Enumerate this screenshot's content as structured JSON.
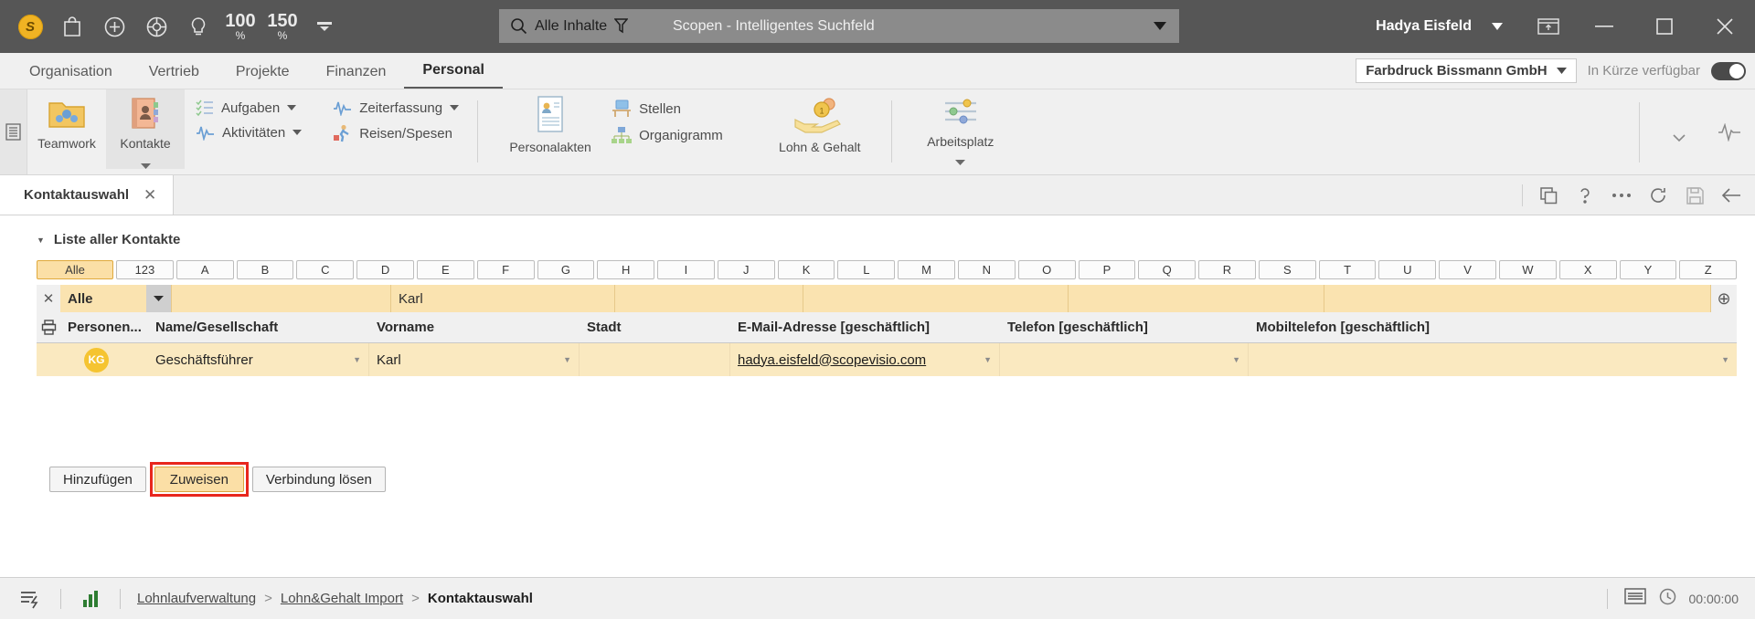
{
  "titlebar": {
    "icons": [
      "app-logo-icon",
      "shop-bag-icon",
      "plus-circle-icon",
      "lifebuoy-icon",
      "lightbulb-icon"
    ],
    "zoom1": "100",
    "zoom1_unit": "%",
    "zoom2": "150",
    "zoom2_unit": "%",
    "overflow": "more-icon",
    "search_scope": "Alle Inhalte",
    "search_placeholder": "Scopen - Intelligentes Suchfeld",
    "user": "Hadya Eisfeld",
    "window_buttons": [
      "restore-panel",
      "minimize",
      "maximize",
      "close"
    ]
  },
  "menu": {
    "items": [
      {
        "label": "Organisation",
        "active": false
      },
      {
        "label": "Vertrieb",
        "active": false
      },
      {
        "label": "Projekte",
        "active": false
      },
      {
        "label": "Finanzen",
        "active": false
      },
      {
        "label": "Personal",
        "active": true
      }
    ],
    "company": "Farbdruck Bissmann GmbH",
    "availability": "In Kürze verfügbar"
  },
  "ribbon": {
    "group1": [
      {
        "label": "Teamwork",
        "icon": "teamwork-folder-icon",
        "selected": false
      },
      {
        "label": "Kontakte",
        "icon": "contacts-book-icon",
        "selected": true
      }
    ],
    "small1": [
      {
        "label": "Aufgaben",
        "icon": "tasks-icon",
        "caret": true
      },
      {
        "label": "Aktivitäten",
        "icon": "activities-icon",
        "caret": true
      }
    ],
    "small2": [
      {
        "label": "Zeiterfassung",
        "icon": "time-tracking-icon",
        "caret": true
      },
      {
        "label": "Reisen/Spesen",
        "icon": "travel-expenses-icon",
        "caret": false
      }
    ],
    "group2": [
      {
        "label": "Personalakten",
        "icon": "personnel-file-icon"
      }
    ],
    "small3": [
      {
        "label": "Stellen",
        "icon": "job-desk-icon"
      },
      {
        "label": "Organigramm",
        "icon": "org-chart-icon"
      }
    ],
    "group3": [
      {
        "label": "Lohn & Gehalt",
        "icon": "payroll-hand-coin-icon"
      }
    ],
    "group4": [
      {
        "label": "Arbeitsplatz",
        "icon": "workplace-sliders-icon"
      }
    ]
  },
  "doctabs": {
    "tabs": [
      {
        "label": "Kontaktauswahl",
        "closable": true
      }
    ],
    "actions": [
      "duplicate-icon",
      "help-icon",
      "more-icon",
      "refresh-icon",
      "save-icon",
      "back-icon"
    ]
  },
  "list": {
    "title": "Liste aller Kontakte",
    "alphabet": [
      "Alle",
      "123",
      "A",
      "B",
      "C",
      "D",
      "E",
      "F",
      "G",
      "H",
      "I",
      "J",
      "K",
      "L",
      "M",
      "N",
      "O",
      "P",
      "Q",
      "R",
      "S",
      "T",
      "U",
      "V",
      "W",
      "X",
      "Y",
      "Z"
    ],
    "active_alpha": "Alle",
    "filter": {
      "clear": "close-icon",
      "scope_value": "Alle",
      "values": [
        "",
        "Karl",
        "",
        "",
        "",
        ""
      ],
      "add": "plus-icon"
    },
    "columns": [
      "Personen...",
      "Name/Gesellschaft",
      "Vorname",
      "Stadt",
      "E-Mail-Adresse [geschäftlich]",
      "Telefon [geschäftlich]",
      "Mobiltelefon [geschäftlich]"
    ],
    "rows": [
      {
        "avatar": "KG",
        "name": "Geschäftsführer",
        "vorname": "Karl",
        "stadt": "",
        "email": "hadya.eisfeld@scopevisio.com",
        "telefon": "",
        "mobil": ""
      }
    ]
  },
  "buttons": {
    "add": "Hinzufügen",
    "assign": "Zuweisen",
    "unlink": "Verbindung lösen"
  },
  "statusbar": {
    "left_icons": [
      "workflow-icon",
      "chart-bars-icon"
    ],
    "breadcrumb": [
      "Lohnlaufverwaltung",
      "Lohn&Gehalt Import"
    ],
    "breadcrumb_current": "Kontaktauswahl",
    "separator": ">",
    "right_icons": [
      "list-view-icon",
      "clock-icon"
    ],
    "timer": "00:00:00"
  },
  "colors": {
    "accent": "#f0b323",
    "highlight_border": "#e8261d",
    "titlebar_bg": "#565656",
    "row_bg": "#fae9c0"
  }
}
